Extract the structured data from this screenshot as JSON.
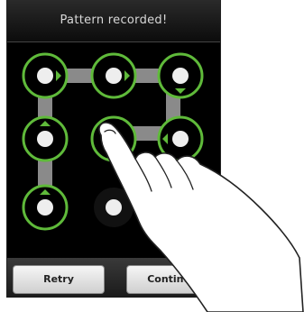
{
  "header": {
    "title": "Pattern recorded!"
  },
  "buttons": {
    "retry_label": "Retry",
    "continue_label": "Continue"
  },
  "pattern": {
    "sequence": [
      1,
      2,
      3,
      6,
      5
    ],
    "second_stroke": [
      7,
      4,
      1
    ],
    "accent_color": "#5fba3a",
    "path_color": "#8a8a8a"
  },
  "icons": {
    "hand": "pointing-hand-icon"
  }
}
